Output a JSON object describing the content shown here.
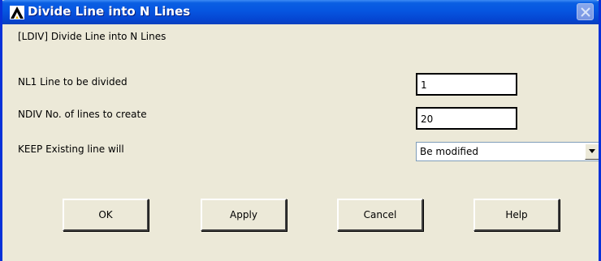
{
  "window": {
    "title": "Divide Line into N Lines"
  },
  "header": {
    "command": "[LDIV]  Divide Line into N Lines"
  },
  "fields": [
    {
      "label": "NL1   Line to be divided",
      "value": "1"
    },
    {
      "label": "NDIV  No. of lines to create",
      "value": "20"
    }
  ],
  "keep": {
    "label": "KEEP  Existing line will",
    "selected": "Be modified"
  },
  "buttons": {
    "ok": "OK",
    "apply": "Apply",
    "cancel": "Cancel",
    "help": "Help"
  },
  "colors": {
    "titlebar": "#0655e0",
    "dialog_bg": "#ece9d8"
  },
  "icons": {
    "app": "ansys-logo-icon",
    "close": "close-icon",
    "dropdown": "chevron-down-icon"
  }
}
